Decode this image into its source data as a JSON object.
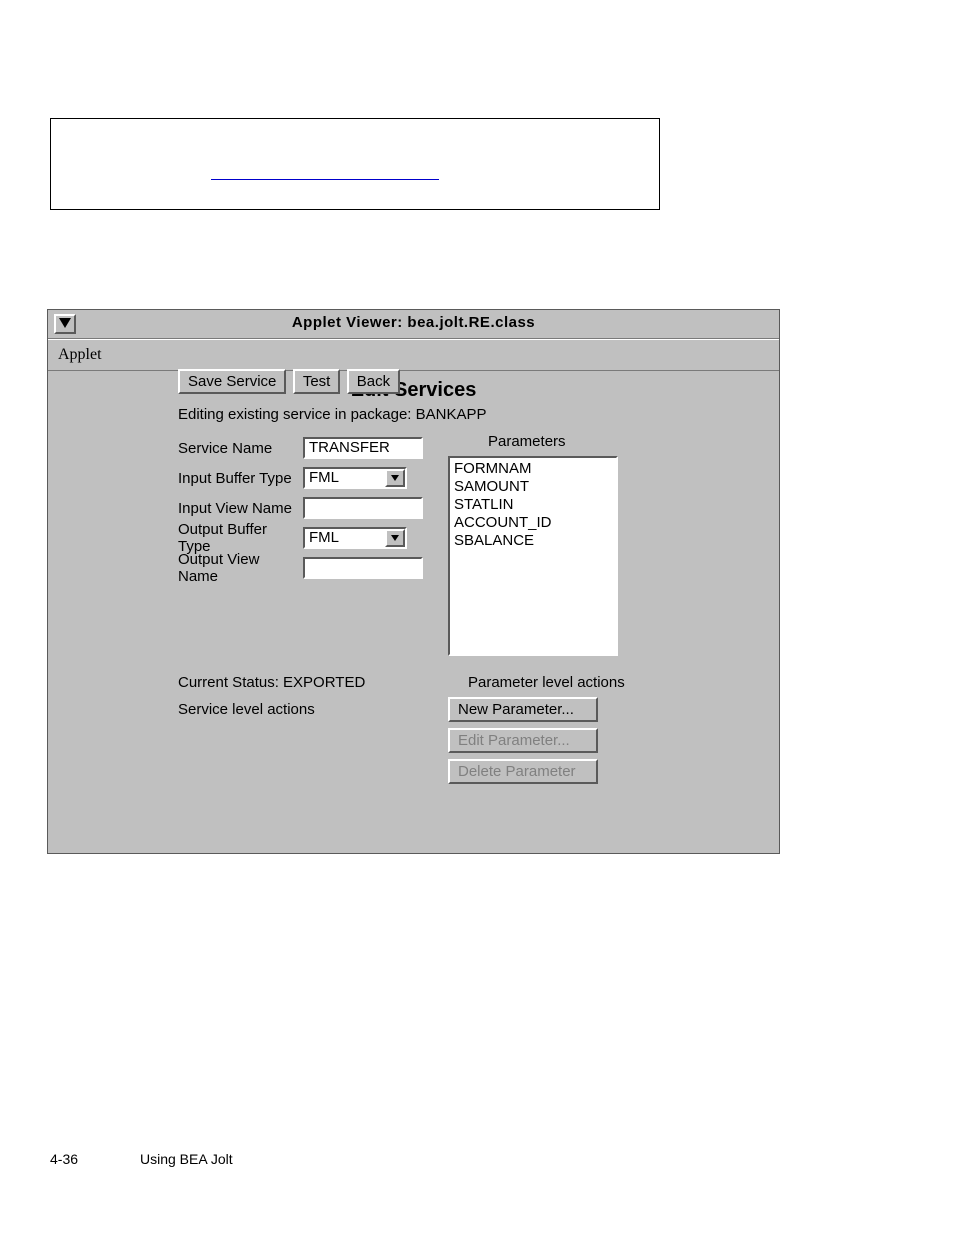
{
  "window": {
    "title": "Applet Viewer: bea.jolt.RE.class",
    "menu": {
      "applet": "Applet"
    }
  },
  "form": {
    "heading": "Edit Services",
    "subtitle": "Editing existing service in package: BANKAPP",
    "labels": {
      "serviceName": "Service Name",
      "inputBufferType": "Input Buffer Type",
      "inputViewName": "Input View Name",
      "outputBufferType": "Output Buffer Type",
      "outputViewName": "Output View Name",
      "parameters": "Parameters",
      "currentStatus": "Current Status: EXPORTED",
      "serviceLevelActions": "Service level actions",
      "parameterLevelActions": "Parameter level actions"
    },
    "values": {
      "serviceName": "TRANSFER",
      "inputBufferType": "FML",
      "inputViewName": "",
      "outputBufferType": "FML",
      "outputViewName": ""
    },
    "parametersList": [
      "FORMNAM",
      "SAMOUNT",
      "STATLIN",
      "ACCOUNT_ID",
      "SBALANCE"
    ],
    "buttons": {
      "newParameter": "New Parameter...",
      "editParameter": "Edit Parameter...",
      "deleteParameter": "Delete Parameter",
      "saveService": "Save Service",
      "test": "Test",
      "back": "Back"
    }
  },
  "footer": {
    "pageNum": "4-36",
    "text": "Using BEA Jolt"
  }
}
